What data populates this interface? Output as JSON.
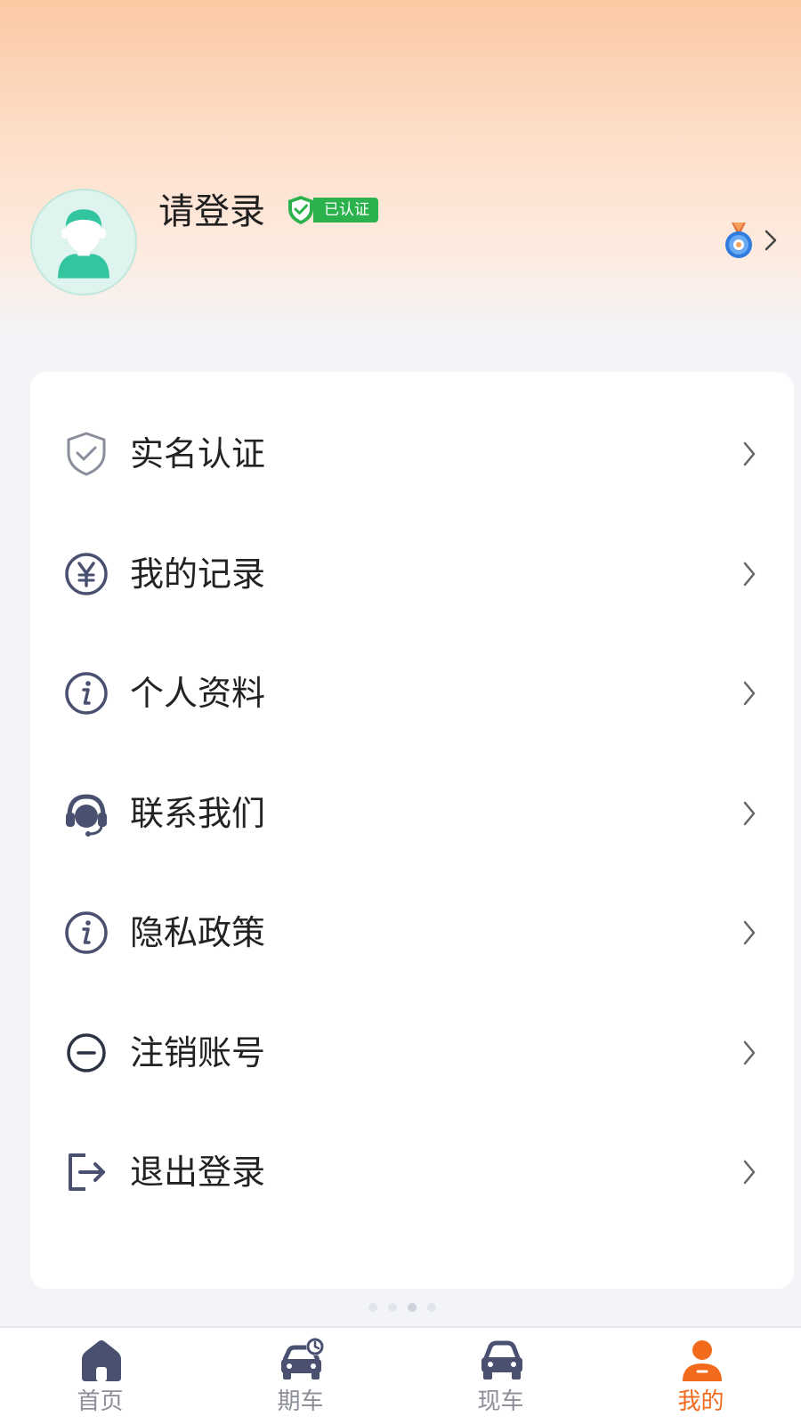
{
  "colors": {
    "header_gradient_top": "#fcc9a4",
    "page_background": "#f3f4f8",
    "verified_green": "#2bb24c",
    "accent_orange": "#f26b1d",
    "icon_gray": "#4a5170",
    "tab_inactive": "#8c8f99"
  },
  "profile": {
    "avatar_icon": "user-avatar-icon",
    "username": "请登录",
    "verified_badge_label": "已认证",
    "medal_icon": "medal-icon"
  },
  "menu": {
    "items": [
      {
        "label": "实名认证",
        "icon": "shield-check-icon"
      },
      {
        "label": "我的记录",
        "icon": "yuan-circle-icon"
      },
      {
        "label": "个人资料",
        "icon": "info-circle-icon"
      },
      {
        "label": "联系我们",
        "icon": "headset-icon"
      },
      {
        "label": "隐私政策",
        "icon": "info-circle-icon"
      },
      {
        "label": "注销账号",
        "icon": "minus-circle-icon"
      },
      {
        "label": "退出登录",
        "icon": "logout-icon"
      }
    ]
  },
  "tabbar": {
    "tabs": [
      {
        "label": "首页",
        "icon": "home-icon",
        "active": false
      },
      {
        "label": "期车",
        "icon": "car-clock-icon",
        "active": false
      },
      {
        "label": "现车",
        "icon": "car-icon",
        "active": false
      },
      {
        "label": "我的",
        "icon": "person-icon",
        "active": true
      }
    ]
  }
}
